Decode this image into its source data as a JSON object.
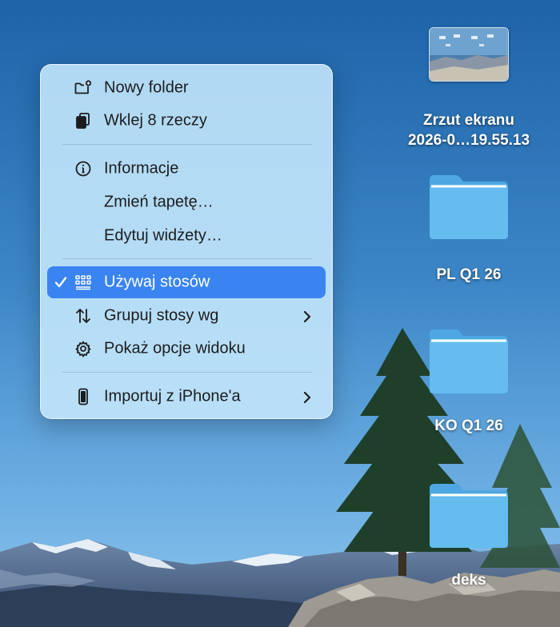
{
  "menu": {
    "items": [
      {
        "label": "Nowy folder",
        "icon": "new-folder-icon"
      },
      {
        "label": "Wklej 8 rzeczy",
        "icon": "paste-icon"
      },
      {
        "label": "Informacje",
        "icon": "info-icon"
      },
      {
        "label": "Zmień tapetę…",
        "icon": ""
      },
      {
        "label": "Edytuj widżety…",
        "icon": ""
      },
      {
        "label": "Używaj stosów",
        "icon": "stacks-icon",
        "checked": true,
        "selected": true
      },
      {
        "label": "Grupuj stosy wg",
        "icon": "sort-arrows-icon",
        "submenu": true
      },
      {
        "label": "Pokaż opcje widoku",
        "icon": "gear-icon"
      },
      {
        "label": "Importuj z iPhone'a",
        "icon": "iphone-icon",
        "submenu": true
      }
    ]
  },
  "desktop": {
    "screenshot": {
      "line1": "Zrzut ekranu",
      "line2": "2026-0…19.55.13"
    },
    "folders": [
      {
        "label": "PL Q1 26"
      },
      {
        "label": "KO Q1 26"
      },
      {
        "label": "deks"
      }
    ]
  },
  "colors": {
    "selection": "#3a84f2",
    "folder": "#5fb8ec",
    "menu_bg": "#c6e8fc"
  }
}
